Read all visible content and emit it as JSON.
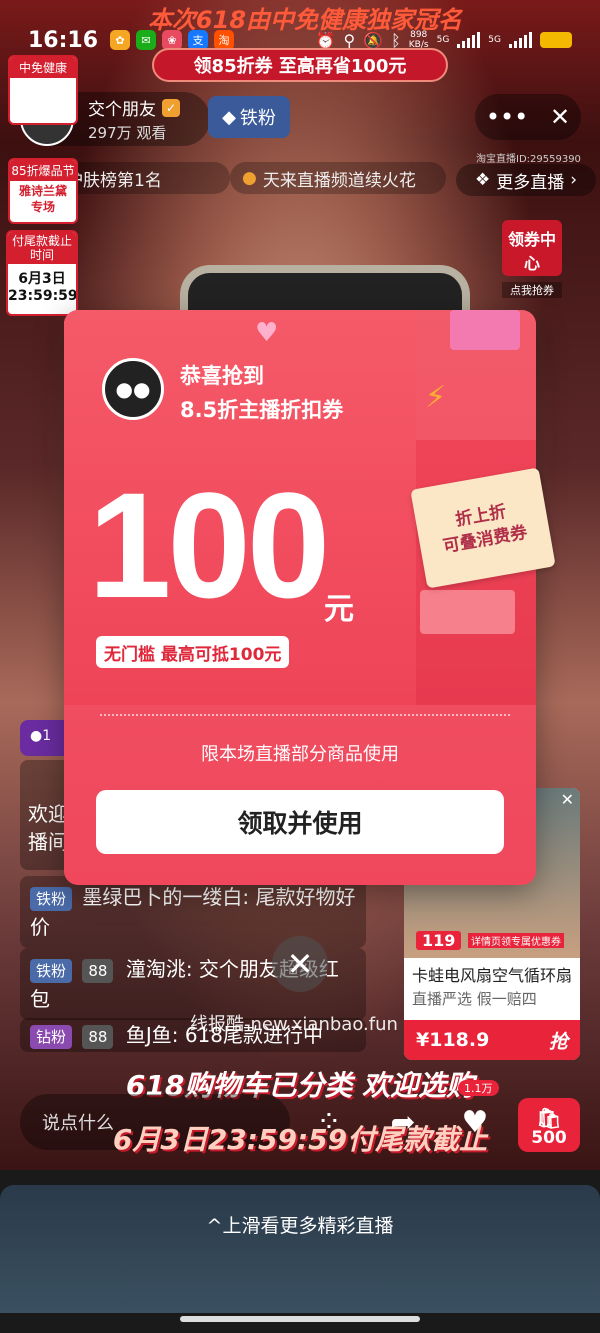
{
  "status_bar": {
    "time": "16:16",
    "net_speed_value": "898",
    "net_speed_unit": "KB/s",
    "network_1": "5G",
    "network_2": "5G",
    "icons": [
      "soul-icon",
      "wechat-icon",
      "flower-icon",
      "alipay-icon",
      "taobao-icon",
      "alarm-icon",
      "location-icon",
      "mute-icon",
      "bluetooth-icon",
      "battery-icon"
    ]
  },
  "stream_banner": {
    "headline": "本次618由中免健康独家冠名",
    "coupon_banner": "领85折券 至高再省100元"
  },
  "host": {
    "name": "交个朋友",
    "viewers": "297万 观看",
    "fan_badge": "铁粉",
    "room_id": "淘宝直播ID:29559390"
  },
  "rank_bar": {
    "rank_text": "美容护肤榜第1名",
    "channel_text": "天来直播频道续火花"
  },
  "more_live": "更多直播",
  "left_badges": {
    "sponsor": "中免健康",
    "promo_header": "85折爆品节",
    "promo_body": "雅诗兰黛专场",
    "deadline_header": "付尾款截止时间",
    "deadline_date": "6月3日",
    "deadline_time": "23:59:59"
  },
  "right_widget": {
    "title": "领券中心",
    "subtitle": "点我抢券"
  },
  "coupon": {
    "congrats": "恭喜抢到",
    "type": "8.5折主播折扣券",
    "amount": "100",
    "unit": "元",
    "threshold": "无门槛 最高可抵100元",
    "stack_line1": "折上折",
    "stack_line2": "可叠消费券",
    "scope": "限本场直播部分商品使用",
    "claim_label": "领取并使用"
  },
  "chat": {
    "welcome": "欢迎 播间",
    "messages": [
      {
        "fan": "铁粉",
        "level": "",
        "text": "墨绿巴卜的一缕白: 尾款好物好价"
      },
      {
        "fan": "铁粉",
        "level": "88",
        "text": "潼淘洮: 交个朋友超级红包"
      },
      {
        "fan": "钻粉",
        "level": "88",
        "text": "鱼J鱼: 618尾款进行中"
      }
    ]
  },
  "watermark": "线报酷-new.xianbao.fun",
  "product": {
    "image_price": "119",
    "image_caption": "详情页领专属优惠券",
    "title": "卡蛙电风扇空气循环扇",
    "tags": "直播严选  假一赔四",
    "price": "¥118.9",
    "buy_label": "抢"
  },
  "promo_overlay": {
    "line1": "618购物车已分类 欢迎选购",
    "line2": "6月3日23:59:59付尾款截止"
  },
  "bottom_bar": {
    "comment_placeholder": "说点什么",
    "like_count": "1.1万",
    "cart_count": "500"
  },
  "swipe_hint": "^上滑看更多精彩直播",
  "colors": {
    "brand_red": "#e8233a",
    "coupon_pink": "#f0475c",
    "fan_blue": "#4a6aa8"
  }
}
